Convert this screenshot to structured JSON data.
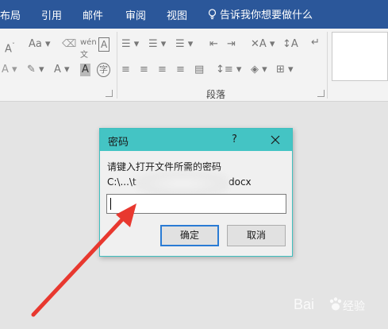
{
  "ribbon_tabs": [
    "布局",
    "引用",
    "邮件",
    "审阅",
    "视图"
  ],
  "tell_me": "告诉我你想要做什么",
  "ribbon_groups": {
    "paragraph_label": "段落"
  },
  "dialog": {
    "title": "密码",
    "help": "?",
    "prompt": "请键入打开文件所需的密码",
    "path_start": "C:\\...\\t",
    "path_end": "docx",
    "password_value": "",
    "ok_label": "确定",
    "cancel_label": "取消"
  },
  "watermark": {
    "text": "Bai",
    "suffix": "经验"
  },
  "colors": {
    "title_bar": "#2b579a",
    "dialog_title": "#44c4c4",
    "arrow": "#e8382f"
  }
}
